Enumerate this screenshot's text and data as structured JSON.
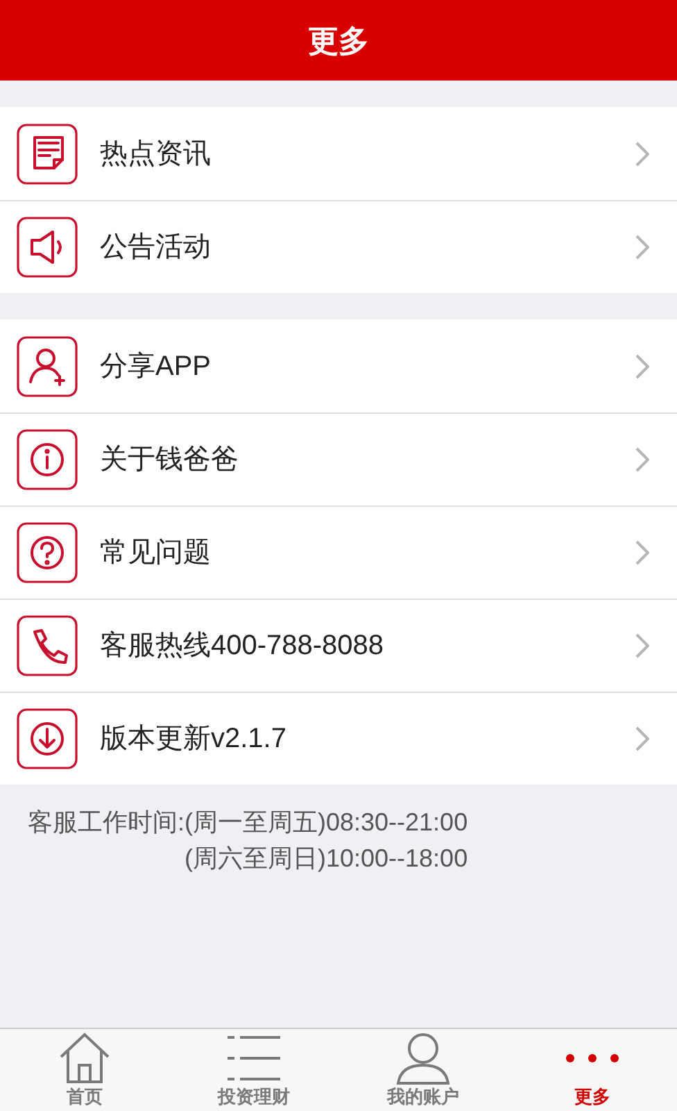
{
  "header": {
    "title": "更多"
  },
  "groups": [
    {
      "items": [
        {
          "label": "热点资讯",
          "kind": "news"
        },
        {
          "label": "公告活动",
          "kind": "speaker"
        }
      ]
    },
    {
      "items": [
        {
          "label": "分享APP",
          "kind": "user-add"
        },
        {
          "label": "关于钱爸爸",
          "kind": "info"
        },
        {
          "label": "常见问题",
          "kind": "question"
        },
        {
          "label": "客服热线400-788-8088",
          "kind": "phone"
        },
        {
          "label": "版本更新v2.1.7",
          "kind": "download"
        }
      ]
    }
  ],
  "service_hours": {
    "label": "客服工作时间:",
    "lines": [
      "(周一至周五)08:30--21:00",
      "(周六至周日)10:00--18:00"
    ]
  },
  "tab_bar": [
    {
      "label": "首页",
      "kind": "home",
      "selected": false
    },
    {
      "label": "投资理财",
      "kind": "list",
      "selected": false
    },
    {
      "label": "我的账户",
      "kind": "user",
      "selected": false
    },
    {
      "label": "更多",
      "kind": "more",
      "selected": true
    }
  ]
}
